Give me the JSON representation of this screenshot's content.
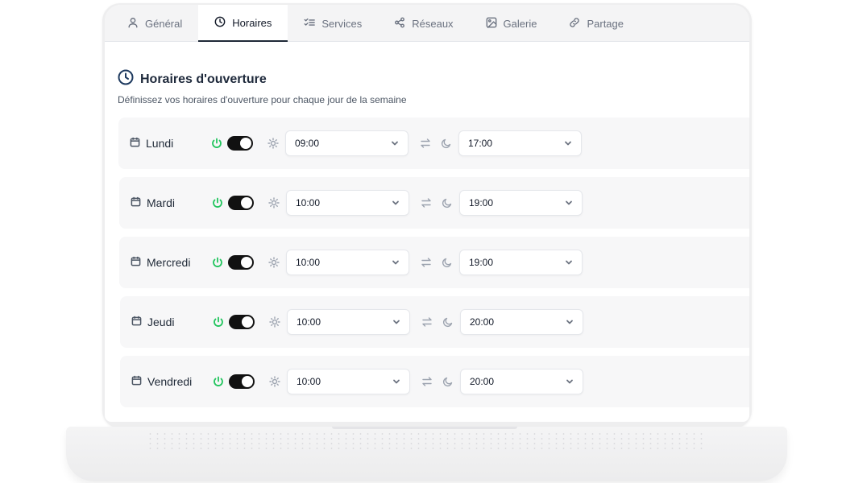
{
  "tabs": [
    {
      "label": "Général",
      "icon": "user-icon"
    },
    {
      "label": "Horaires",
      "icon": "clock-icon",
      "active": true
    },
    {
      "label": "Services",
      "icon": "list-check-icon"
    },
    {
      "label": "Réseaux",
      "icon": "share-icon"
    },
    {
      "label": "Galerie",
      "icon": "image-icon"
    },
    {
      "label": "Partage",
      "icon": "link-icon"
    }
  ],
  "section": {
    "title": "Horaires d'ouverture",
    "subtitle": "Définissez vos horaires d'ouverture pour chaque jour de la semaine"
  },
  "days": [
    {
      "name": "Lundi",
      "enabled": true,
      "open": "09:00",
      "close": "17:00"
    },
    {
      "name": "Mardi",
      "enabled": true,
      "open": "10:00",
      "close": "19:00"
    },
    {
      "name": "Mercredi",
      "enabled": true,
      "open": "10:00",
      "close": "19:00"
    },
    {
      "name": "Jeudi",
      "enabled": true,
      "open": "10:00",
      "close": "20:00"
    },
    {
      "name": "Vendredi",
      "enabled": true,
      "open": "10:00",
      "close": "20:00"
    }
  ],
  "colors": {
    "active_power": "#22c55e",
    "toggle_on": "#111111",
    "heading_icon": "#1e3a5f"
  }
}
